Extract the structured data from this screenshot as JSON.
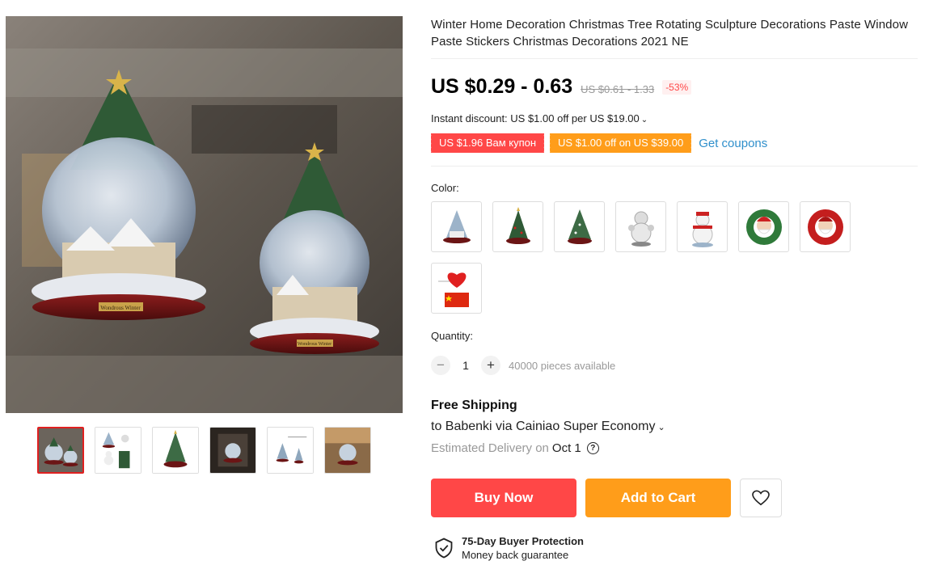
{
  "product": {
    "title": "Winter Home Decoration Christmas Tree Rotating Sculpture Decorations Paste Window Paste Stickers Christmas Decorations 2021 NE"
  },
  "price": {
    "current": "US $0.29 - 0.63",
    "original": "US $0.61 - 1.33",
    "discount": "-53%"
  },
  "instant_discount": {
    "text": "Instant discount: US $1.00 off per US $19.00"
  },
  "coupons": {
    "items": [
      "US $1.96 Вам купон",
      "US $1.00 off on US $39.00"
    ],
    "get_label": "Get coupons"
  },
  "color": {
    "label": "Color:",
    "options": [
      "snowglobe-tree",
      "tree-sculpture",
      "green-tree",
      "snowman-silver",
      "snowman-red",
      "santa-wreath-green",
      "santa-wreath-red",
      "heart-flag"
    ]
  },
  "quantity": {
    "label": "Quantity:",
    "value": "1",
    "available": "40000 pieces available"
  },
  "shipping": {
    "title": "Free Shipping",
    "to": "to Babenki via Cainiao Super Economy",
    "estimated_label": "Estimated Delivery on",
    "date": "Oct 1"
  },
  "actions": {
    "buy_now": "Buy Now",
    "add_to_cart": "Add to Cart"
  },
  "protection": {
    "title": "75-Day Buyer Protection",
    "subtitle": "Money back guarantee"
  },
  "gallery": {
    "main_label_1": "Wondrous Winter",
    "main_label_2": "Wondrous Winter",
    "thumb_count": 6,
    "active_thumb": 0
  },
  "colors": {
    "price_red": "#ff4747",
    "orange": "#ff9d1a",
    "link_blue": "#2f8fcb"
  }
}
